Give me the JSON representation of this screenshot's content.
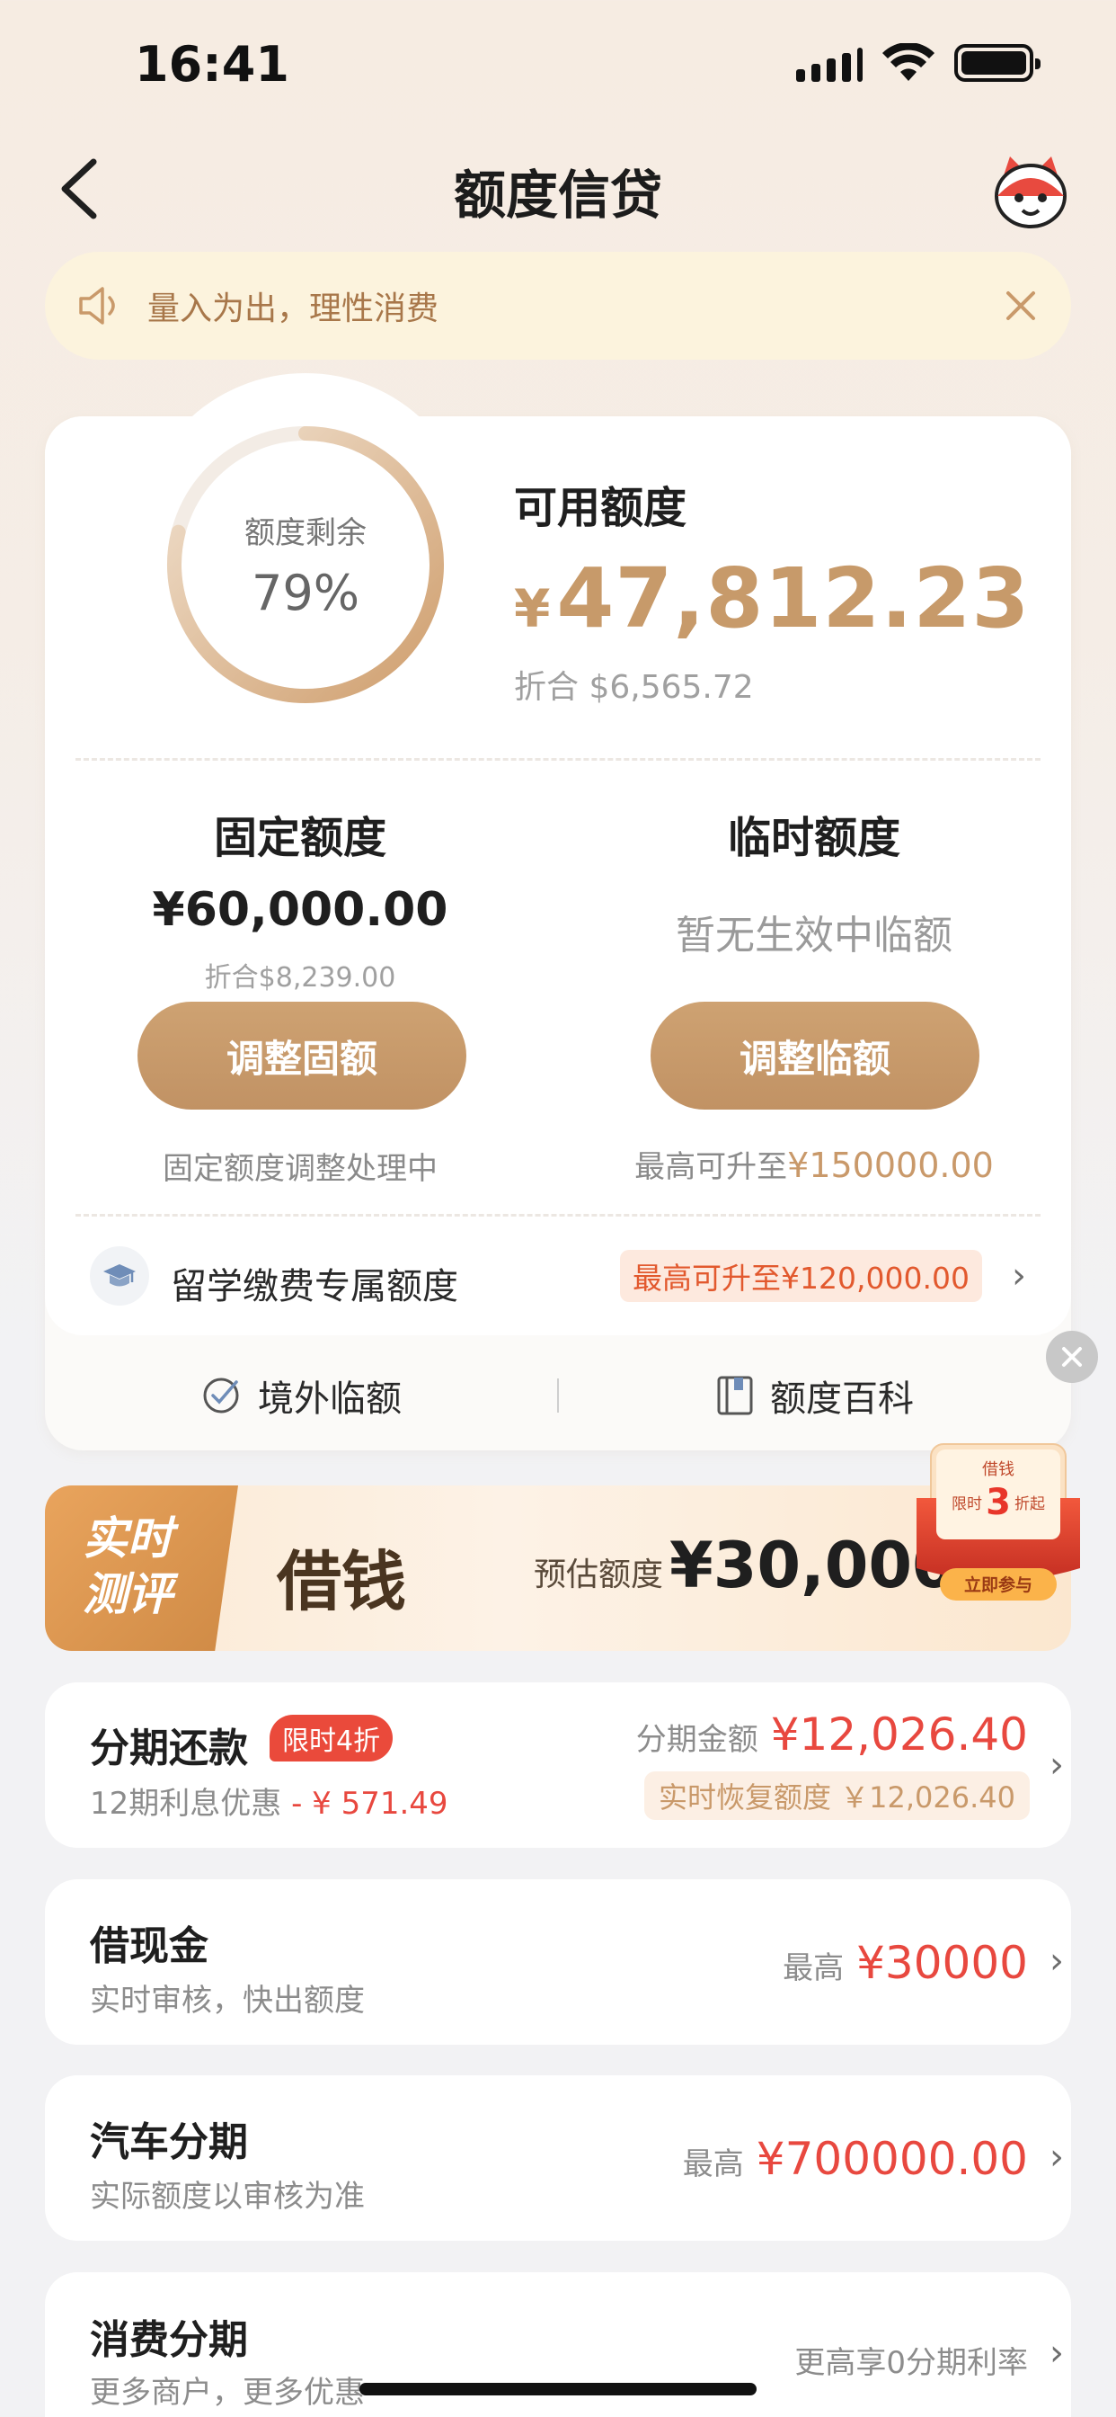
{
  "status": {
    "time": "16:41"
  },
  "nav": {
    "title": "额度信贷"
  },
  "notice": {
    "text": "量入为出，理性消费"
  },
  "credit": {
    "ring_label": "额度剩余",
    "ring_percent": "79%",
    "ring_fraction": 0.79,
    "available_label": "可用额度",
    "available_currency": "¥",
    "available_amount": "47,812.23",
    "available_converted": "折合  $6,565.72"
  },
  "fixed": {
    "title": "固定额度",
    "amount": "¥60,000.00",
    "converted": "折合$8,239.00",
    "button": "调整固额",
    "note": "固定额度调整处理中"
  },
  "temporary": {
    "title": "临时额度",
    "status": "暂无生效中临额",
    "button": "调整临额",
    "note_prefix": "最高可升至",
    "note_amount": "¥150000.00"
  },
  "study": {
    "label": "留学缴费专属额度",
    "badge": "最高可升至¥120,000.00"
  },
  "links": {
    "overseas": "境外临额",
    "wiki": "额度百科"
  },
  "banner": {
    "tag_line1": "实时",
    "tag_line2": "测评",
    "title": "借钱",
    "estimate_label": "预估额度",
    "estimate_amount": "¥30,000.",
    "promo_top": "借钱",
    "promo_prefix": "限时",
    "promo_num": "3",
    "promo_suffix": "折起",
    "promo_button": "立即参与"
  },
  "installment": {
    "title": "分期还款",
    "badge": "限时4折",
    "sub_prefix": "12期利息优惠",
    "sub_discount": "- ¥ 571.49",
    "amount_label": "分期金额",
    "amount": "¥12,026.40",
    "restore": "实时恢复额度 ￥12,026.40"
  },
  "cash": {
    "title": "借现金",
    "sub": "实时审核，快出额度",
    "max_label": "最高",
    "max_amount": "¥30000"
  },
  "car": {
    "title": "汽车分期",
    "sub": "实际额度以审核为准",
    "max_label": "最高",
    "max_amount": "¥700000.00"
  },
  "consumer": {
    "title": "消费分期",
    "sub": "更多商户，更多优惠",
    "right": "更高享0分期利率"
  },
  "colors": {
    "gold": "#c79a6a",
    "red": "#e8483f",
    "ring_bg": "#f3ece5"
  }
}
